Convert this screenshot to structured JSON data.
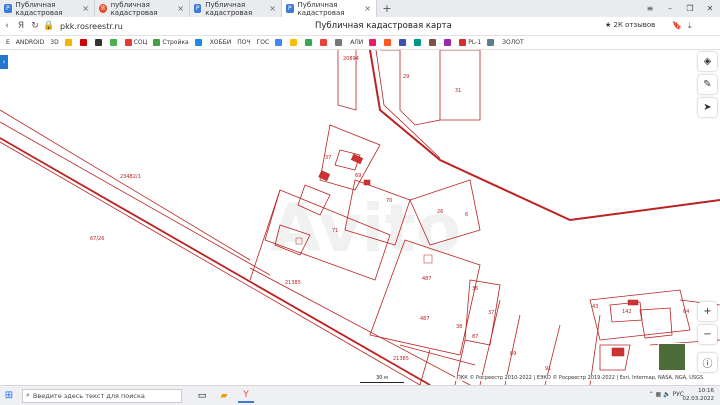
{
  "tabs": [
    {
      "label": "Публичная кадастровая",
      "icon": "rosreestr-icon",
      "color": "#3a7bd5"
    },
    {
      "label": "публичная кадастровая",
      "icon": "yandex-icon",
      "color": "#e34a2a"
    },
    {
      "label": "Публичная кадастровая",
      "icon": "rosreestr-icon",
      "color": "#3a7bd5"
    },
    {
      "label": "Публичная кадастровая",
      "icon": "rosreestr-icon",
      "color": "#3a7bd5",
      "active": true
    }
  ],
  "address": {
    "url": "pkk.rosreestr.ru",
    "page_title": "Публичная кадастровая карта",
    "reviews": "★ 2К отзывов"
  },
  "bookmarks": [
    "Е",
    "ANDROID",
    "3D",
    "",
    "",
    "",
    "",
    "СОЦ",
    "Стройка",
    "",
    "ХОББИ",
    "ПОЧ",
    "ГОС",
    "",
    "",
    "",
    "",
    "",
    "АЛИ",
    "",
    "",
    "",
    "",
    "",
    "",
    "PL-1",
    "",
    "ЗОЛОТ"
  ],
  "map": {
    "parcel_labels": [
      "20894",
      "29",
      "31",
      "37",
      "69",
      "70",
      "26",
      "6",
      "71",
      "23482/1",
      "67/26",
      "21385",
      "487",
      "487",
      "36",
      "38",
      "37",
      "87",
      "89",
      "91",
      "43",
      "142",
      "64",
      "21385"
    ],
    "scale_label": "30 м",
    "copyright": "ПКК © Росреестр 2010-2022 | ЕЭКО © Росреестр 2019-2022 | Esri, Intermap, NASA, NGA, USGS"
  },
  "taskbar": {
    "search_placeholder": "Введите здесь текст для поиска",
    "lang": "РУС",
    "time": "10:16",
    "date": "02.03.2022"
  }
}
